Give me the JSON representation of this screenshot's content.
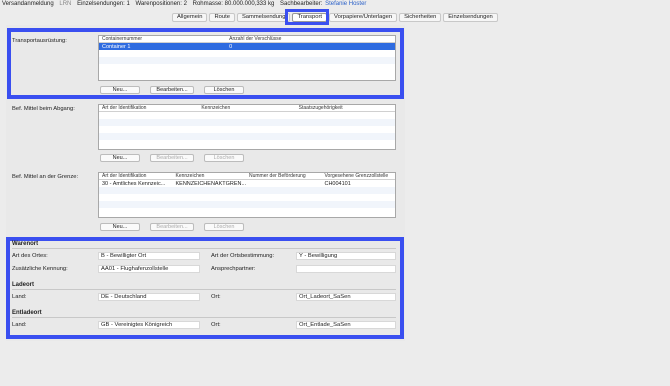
{
  "header": {
    "title": "Versandanmeldung",
    "lrn_label": "LRN",
    "einzelsendungen": "Einzelsendungen: 1",
    "warenpositionen": "Warenpositionen: 2",
    "rohmasse": "Rohmasse: 80.000.000,333 kg",
    "sachbearbeiter_label": "Sachbearbeiter:",
    "sachbearbeiter_name": "Stefanie Hoster"
  },
  "tabs": [
    "Allgemein",
    "Route",
    "Sammelsendung",
    "Transport",
    "Vorpapiere/Unterlagen",
    "Sicherheiten",
    "Einzelsendungen"
  ],
  "active_tab": "Transport",
  "transportausruestung": {
    "label": "Transportausrüstung:",
    "columns": [
      "Containernummer",
      "Anzahl der Verschlüsse"
    ],
    "rows": [
      [
        "Container 1",
        "0"
      ]
    ],
    "buttons": {
      "new": "Neu...",
      "edit": "Bearbeiten...",
      "delete": "Löschen"
    }
  },
  "abgang": {
    "label": "Bef. Mittel beim Abgang:",
    "columns": [
      "Art der Identifikation",
      "Kennzeichen",
      "Staatszugehörigkeit"
    ],
    "rows": [],
    "buttons": {
      "new": "Neu...",
      "edit": "Bearbeiten...",
      "delete": "Löschen"
    }
  },
  "grenze": {
    "label": "Bef. Mittel an der Grenze:",
    "columns": [
      "Art der Identifikation",
      "Kennzeichen",
      "Nummer der Beförderung",
      "Vorgesehene Grenzzollstelle"
    ],
    "rows": [
      [
        "30 - Amtliches Kennzeic...",
        "KENNZEICHENAKTGREN...",
        "",
        "CH004101"
      ]
    ],
    "buttons": {
      "new": "Neu...",
      "edit": "Bearbeiten...",
      "delete": "Löschen"
    }
  },
  "warenort": {
    "title": "Warenort",
    "art_des_ortes_label": "Art des Ortes:",
    "art_des_ortes_value": "B - Bewilligter Ort",
    "art_ortsbestimmung_label": "Art der Ortsbestimmung:",
    "art_ortsbestimmung_value": "Y - Bewilligung",
    "zus_kennung_label": "Zusätzliche Kennung:",
    "zus_kennung_value": "AA01 - Flughafenzollstelle",
    "ansprechpartner_label": "Ansprechpartner:",
    "ansprechpartner_value": ""
  },
  "ladeort": {
    "title": "Ladeort",
    "land_label": "Land:",
    "land_value": "DE - Deutschland",
    "ort_label": "Ort:",
    "ort_value": "Ort_Ladeort_SaSen"
  },
  "entladeort": {
    "title": "Entladeort",
    "land_label": "Land:",
    "land_value": "GB - Vereinigtes Königreich",
    "ort_label": "Ort:",
    "ort_value": "Ort_Entlade_SaSen"
  }
}
